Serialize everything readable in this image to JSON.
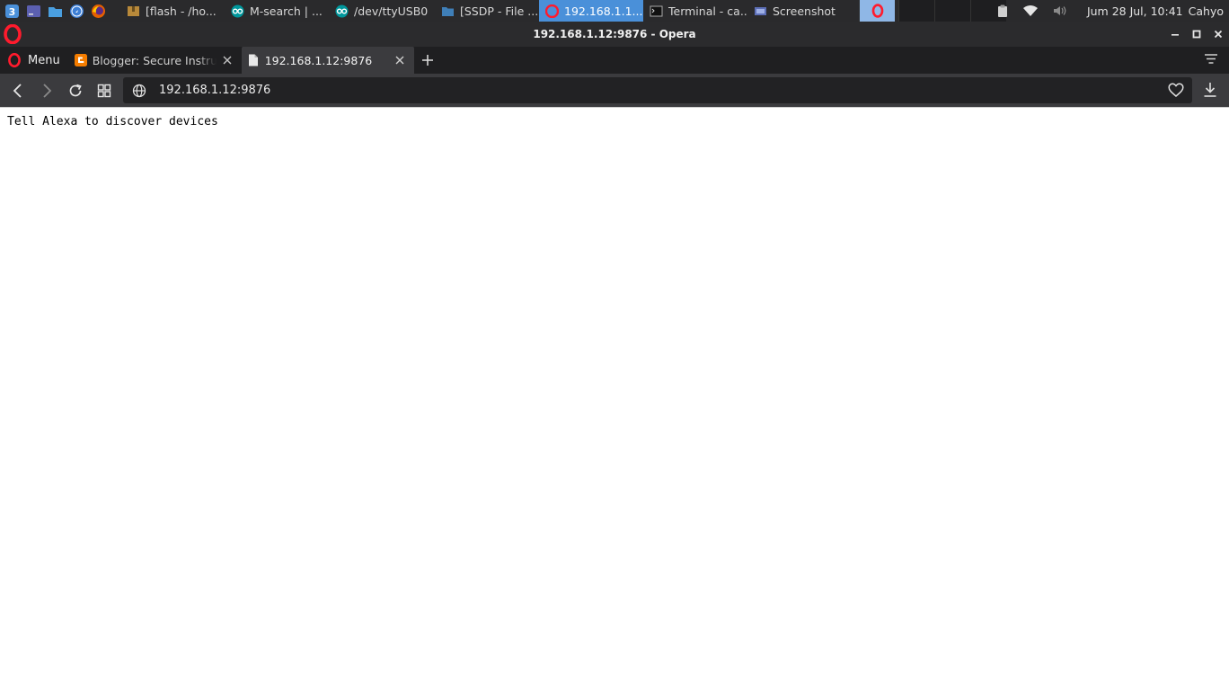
{
  "panel": {
    "launchers": [
      {
        "icon": "whisker-menu-icon",
        "color": "#4a90d9"
      },
      {
        "icon": "terminal-launcher-icon",
        "color": "#5b5fb0"
      },
      {
        "icon": "file-manager-launcher-icon",
        "color": "#4a9fe0"
      },
      {
        "icon": "web-browser-launcher-icon",
        "color": "#3d7fd6"
      },
      {
        "icon": "firefox-launcher-icon",
        "color": "#e66000"
      }
    ],
    "tasks": [
      {
        "label": "[flash - /ho...",
        "icon": "archive-manager-icon",
        "active": false
      },
      {
        "label": "M-search | ...",
        "icon": "arduino-icon",
        "active": false
      },
      {
        "label": "/dev/ttyUSB0",
        "icon": "arduino-icon",
        "active": false
      },
      {
        "label": "[SSDP - File ...",
        "icon": "folder-icon",
        "active": false
      },
      {
        "label": "192.168.1.1...",
        "icon": "opera-icon",
        "active": true
      },
      {
        "label": "Terminal - ca...",
        "icon": "terminal-icon",
        "active": false
      },
      {
        "label": "Screenshot",
        "icon": "screenshot-icon",
        "active": false
      }
    ],
    "clock": "Jum 28 Jul, 10:41",
    "user": "Cahyo"
  },
  "window": {
    "title": "192.168.1.12:9876 - Opera"
  },
  "browser": {
    "menu_label": "Menu",
    "tabs": [
      {
        "label": "Blogger: Secure Instrum",
        "icon": "blogger-icon",
        "active": false
      },
      {
        "label": "192.168.1.12:9876",
        "icon": "page-icon",
        "active": true
      }
    ],
    "address": "192.168.1.12:9876"
  },
  "page": {
    "text": "Tell Alexa to discover devices"
  },
  "colors": {
    "accent": "#4a90d9",
    "opera_red": "#ff1b2d",
    "blogger_orange": "#f57d00"
  }
}
